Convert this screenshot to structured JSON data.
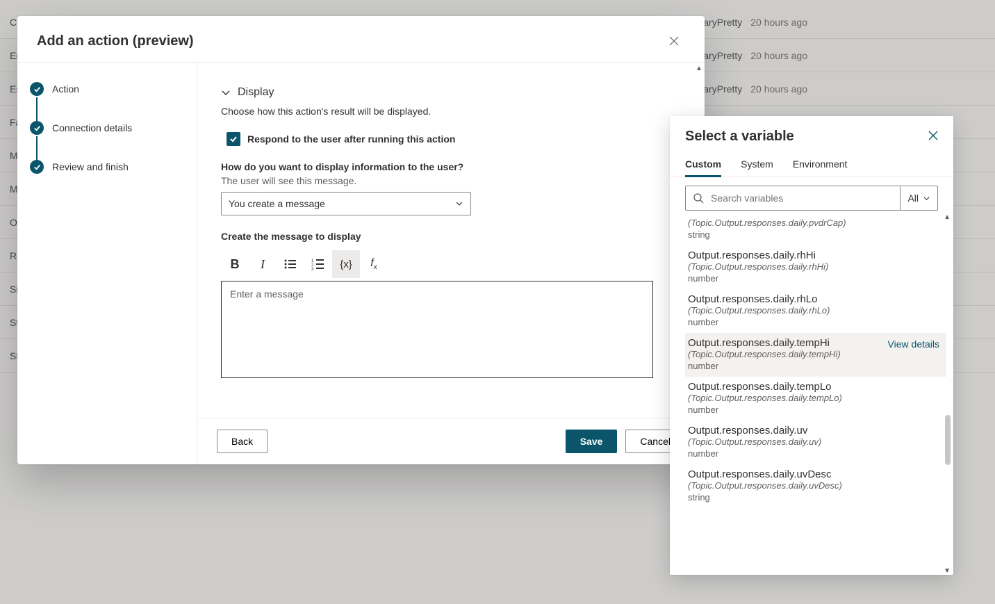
{
  "background": {
    "rows": [
      {
        "label": "Cor",
        "user": "GaryPretty",
        "time": "20 hours ago"
      },
      {
        "label": "End",
        "user": "GaryPretty",
        "time": "20 hours ago"
      },
      {
        "label": "Esc",
        "user": "GaryPretty",
        "time": "20 hours ago"
      },
      {
        "label": "Fall",
        "user": "",
        "time": ""
      },
      {
        "label": "MS",
        "user": "",
        "time": ""
      },
      {
        "label": "Mu",
        "user": "",
        "time": ""
      },
      {
        "label": "On",
        "user": "",
        "time": ""
      },
      {
        "label": "Res",
        "user": "",
        "time": ""
      },
      {
        "label": "Sig",
        "user": "",
        "time": ""
      },
      {
        "label": "Sto",
        "user": "",
        "time": ""
      },
      {
        "label": "Sto",
        "user": "",
        "time": ""
      }
    ]
  },
  "modal": {
    "title": "Add an action (preview)",
    "steps": [
      "Action",
      "Connection details",
      "Review and finish"
    ],
    "display": {
      "section_title": "Display",
      "section_desc": "Choose how this action's result will be displayed.",
      "checkbox_label": "Respond to the user after running this action",
      "question": "How do you want to display information to the user?",
      "subtext": "The user will see this message.",
      "select_value": "You create a message",
      "create_label": "Create the message to display",
      "editor_placeholder": "Enter a message"
    },
    "footer": {
      "back": "Back",
      "save": "Save",
      "cancel": "Cancel"
    }
  },
  "var_panel": {
    "title": "Select a variable",
    "tabs": [
      "Custom",
      "System",
      "Environment"
    ],
    "search_placeholder": "Search variables",
    "filter_label": "All",
    "view_details": "View details",
    "items": [
      {
        "name": "",
        "path": "(Topic.Output.responses.daily.pvdrCap)",
        "type": "string",
        "partial": true
      },
      {
        "name": "Output.responses.daily.rhHi",
        "path": "(Topic.Output.responses.daily.rhHi)",
        "type": "number"
      },
      {
        "name": "Output.responses.daily.rhLo",
        "path": "(Topic.Output.responses.daily.rhLo)",
        "type": "number"
      },
      {
        "name": "Output.responses.daily.tempHi",
        "path": "(Topic.Output.responses.daily.tempHi)",
        "type": "number",
        "hover": true
      },
      {
        "name": "Output.responses.daily.tempLo",
        "path": "(Topic.Output.responses.daily.tempLo)",
        "type": "number"
      },
      {
        "name": "Output.responses.daily.uv",
        "path": "(Topic.Output.responses.daily.uv)",
        "type": "number"
      },
      {
        "name": "Output.responses.daily.uvDesc",
        "path": "(Topic.Output.responses.daily.uvDesc)",
        "type": "string"
      }
    ]
  }
}
